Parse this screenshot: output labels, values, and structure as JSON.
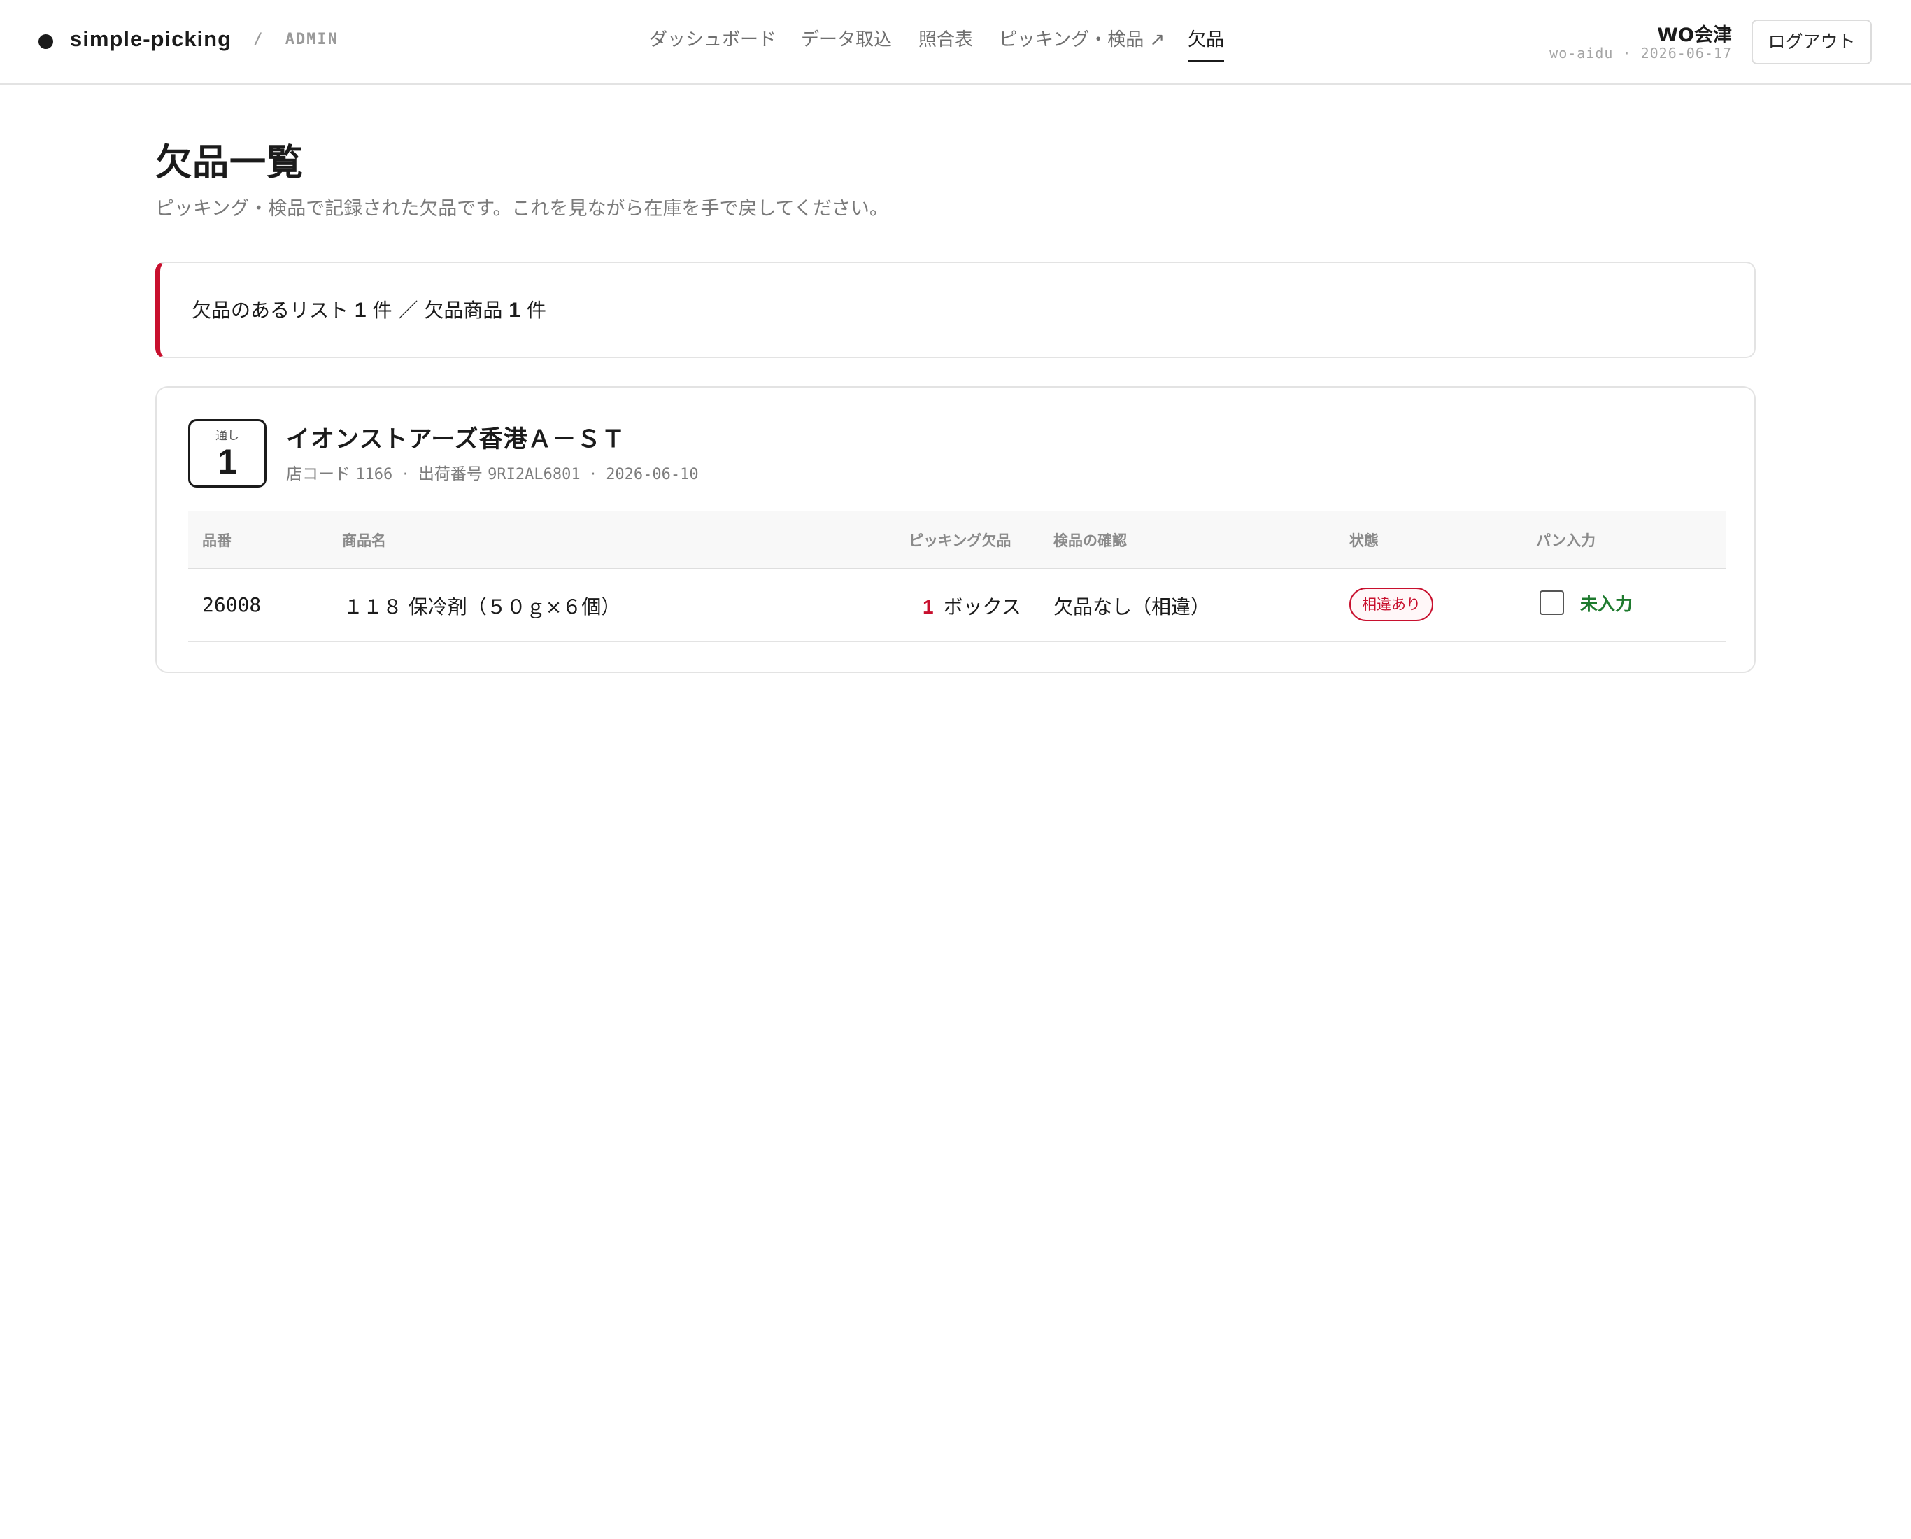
{
  "header": {
    "brand_name": "simple-picking",
    "brand_section": "/  ADMIN",
    "nav": [
      {
        "label": "ダッシュボード"
      },
      {
        "label": "データ取込"
      },
      {
        "label": "照合表"
      },
      {
        "label": "ピッキング・検品 ↗"
      },
      {
        "label": "欠品",
        "active": true
      }
    ],
    "user_name": "WO会津",
    "user_meta": "wo-aidu · 2026-06-17",
    "logout_label": "ログアウト"
  },
  "page": {
    "title": "欠品一覧",
    "subtitle": "ピッキング・検品で記録された欠品です。これを見ながら在庫を手で戻してください。"
  },
  "summary": {
    "lists_label": "欠品のあるリスト",
    "lists_count": "1",
    "lists_unit": "件",
    "separator": "／",
    "items_label": "欠品商品",
    "items_count": "1",
    "items_unit": "件"
  },
  "shortage_lists": [
    {
      "seq_label": "通し",
      "seq_number": "1",
      "store_name": "イオンストアーズ香港Ａ－ＳＴ",
      "store_code_label": "店コード",
      "store_code": "1166",
      "shipment_label": "出荷番号",
      "shipment_no": "9RI2AL6801",
      "date": "2026-06-10",
      "columns": {
        "sku": "品番",
        "product": "商品名",
        "picking_shortage": "ピッキング欠品",
        "inspection": "検品の確認",
        "status": "状態",
        "pan_input": "パン入力"
      },
      "rows": [
        {
          "sku": "26008",
          "product": "１１８ 保冷剤（５０ｇ×６個）",
          "picking_qty": "1",
          "picking_unit": "ボックス",
          "inspection": "欠品なし（相違）",
          "status": "相違あり",
          "pan_checked": false,
          "pan_status": "未入力"
        }
      ]
    }
  ],
  "colors": {
    "accent_red": "#c8102e",
    "pending_green": "#1e7a2e",
    "text": "#1b1b1b"
  }
}
